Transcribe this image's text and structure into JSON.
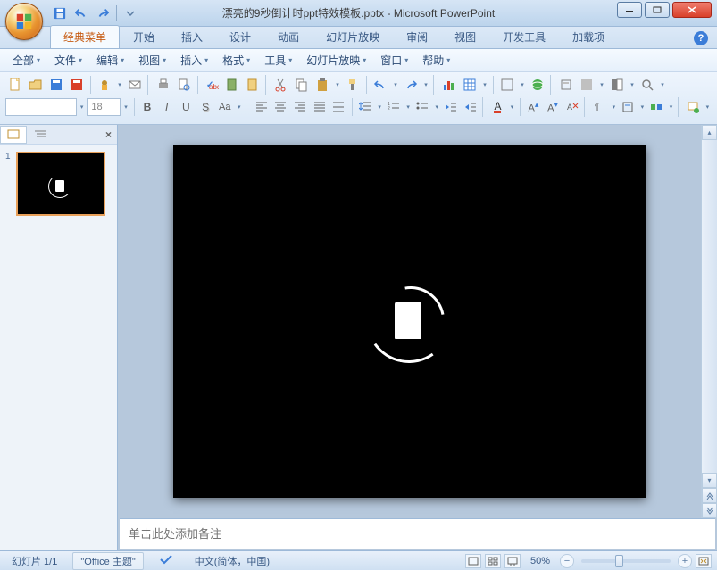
{
  "titlebar": {
    "document_name": "漂亮的9秒倒计时ppt特效模板.pptx",
    "app_name": "Microsoft PowerPoint",
    "separator": " - "
  },
  "ribbon_tabs": [
    "经典菜单",
    "开始",
    "插入",
    "设计",
    "动画",
    "幻灯片放映",
    "审阅",
    "视图",
    "开发工具",
    "加载项"
  ],
  "ribbon_active_index": 0,
  "classic_menu": [
    "全部",
    "文件",
    "编辑",
    "视图",
    "插入",
    "格式",
    "工具",
    "幻灯片放映",
    "窗口",
    "帮助"
  ],
  "font": {
    "name": "",
    "size": "18"
  },
  "slide_panel": {
    "current_slide": "1"
  },
  "notes": {
    "placeholder": "单击此处添加备注"
  },
  "status": {
    "slide_indicator": "幻灯片 1/1",
    "theme": "\"Office 主题\"",
    "language": "中文(简体，中国)",
    "zoom": "50%"
  }
}
